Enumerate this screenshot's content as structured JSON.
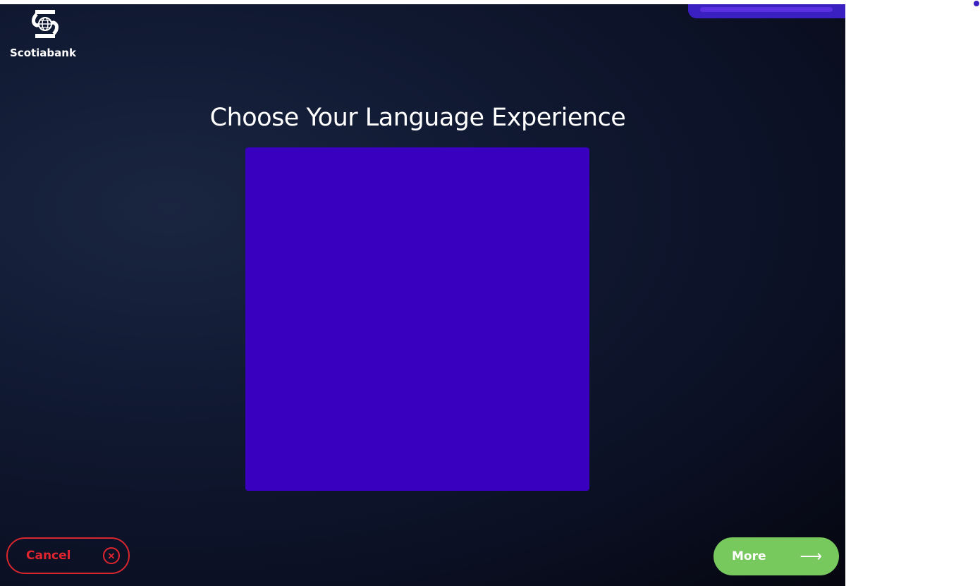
{
  "brand": {
    "name": "Scotiabank",
    "logo_icon": "scotiabank-globe-logo"
  },
  "page": {
    "title": "Choose Your Language Experience"
  },
  "language_panel": {
    "state": "redacted"
  },
  "footer": {
    "cancel_label": "Cancel",
    "cancel_icon": "close-circle-icon",
    "more_label": "More",
    "more_icon": "arrow-right-icon",
    "more_arrow_glyph": "⟶"
  },
  "colors": {
    "background_dark": "#0b1024",
    "redaction": "#3a00bf",
    "cancel": "#e0252f",
    "more": "#78c95d",
    "text": "#ffffff"
  }
}
